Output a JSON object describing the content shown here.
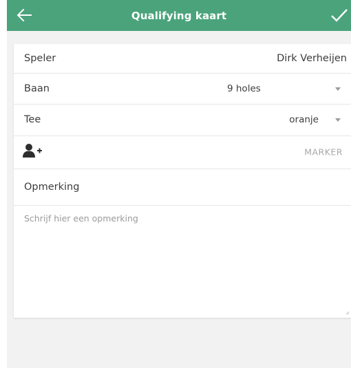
{
  "header": {
    "title": "Qualifying kaart",
    "back_icon": "arrow-left-icon",
    "confirm_icon": "checkmark-icon",
    "background_color": "#4aa37b"
  },
  "form": {
    "player": {
      "label": "Speler",
      "value": "Dirk Verheijen"
    },
    "course": {
      "label": "Baan",
      "value": "9 holes"
    },
    "tee": {
      "label": "Tee",
      "value": "oranje"
    },
    "marker": {
      "icon": "add-person-icon",
      "button_label": "MARKER"
    },
    "remark": {
      "label": "Opmerking",
      "placeholder": "Schrijf hier een opmerking",
      "value": ""
    }
  }
}
